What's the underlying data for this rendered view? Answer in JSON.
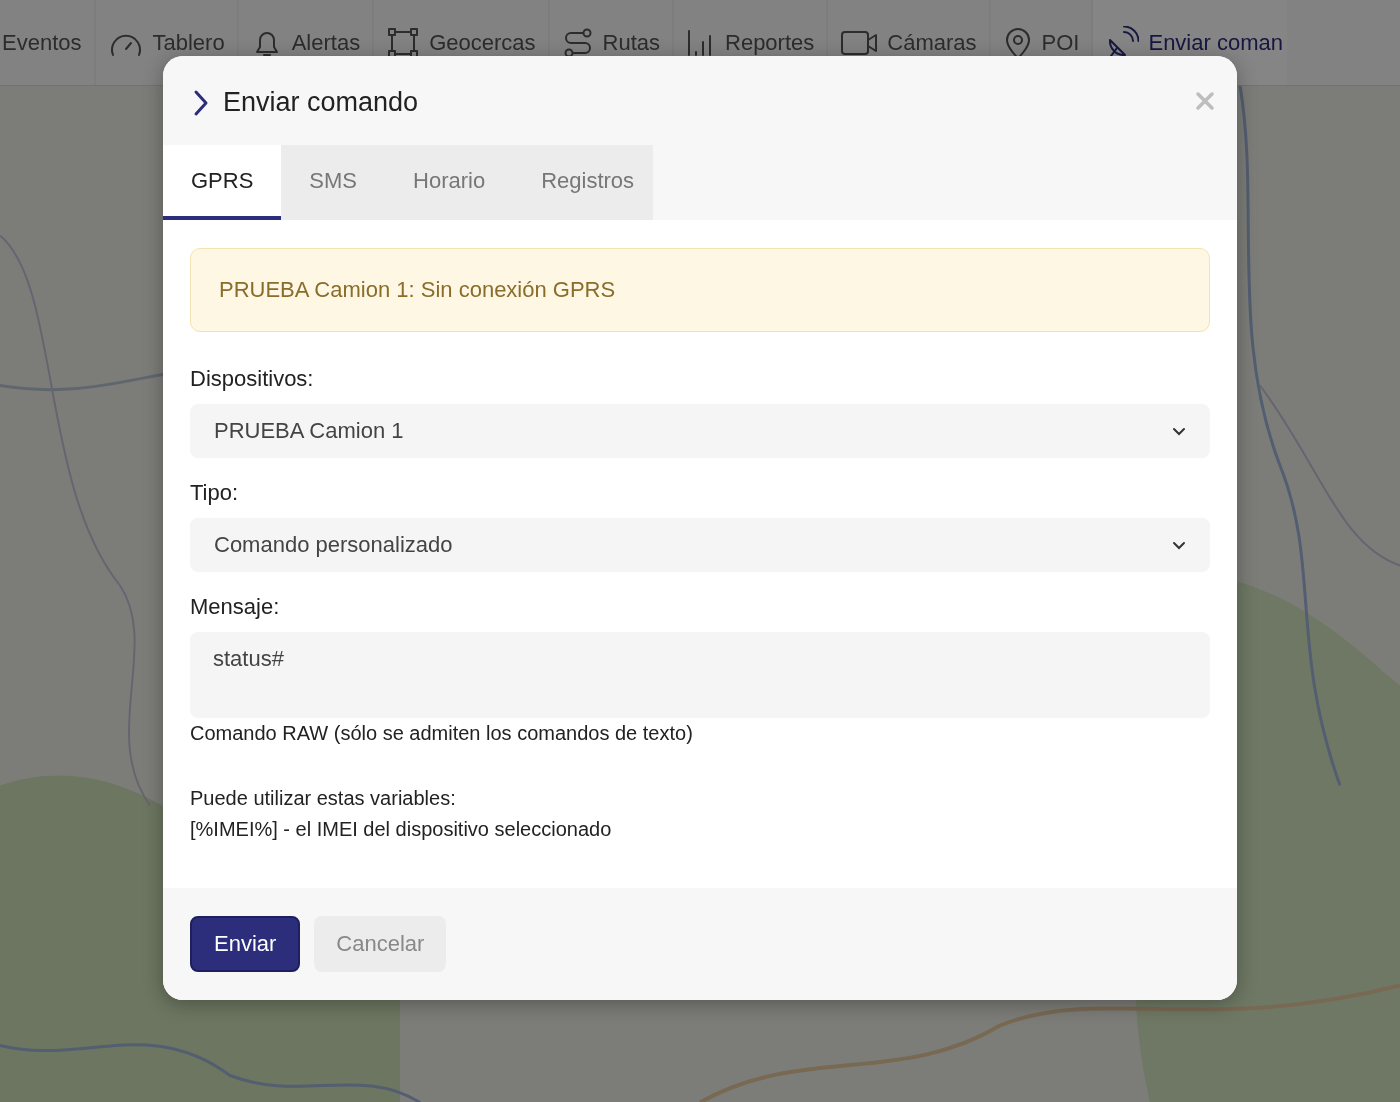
{
  "nav": [
    {
      "label": "Eventos",
      "selected": false
    },
    {
      "label": "Tablero",
      "selected": false
    },
    {
      "label": "Alertas",
      "selected": false
    },
    {
      "label": "Geocercas",
      "selected": false
    },
    {
      "label": "Rutas",
      "selected": false
    },
    {
      "label": "Reportes",
      "selected": false
    },
    {
      "label": "Cámaras",
      "selected": false
    },
    {
      "label": "POI",
      "selected": false
    },
    {
      "label": "Enviar coman",
      "selected": true
    }
  ],
  "dialog": {
    "title": "Enviar comando",
    "tabs": [
      {
        "label": "GPRS",
        "selected": true
      },
      {
        "label": "SMS",
        "selected": false
      },
      {
        "label": "Horario",
        "selected": false
      },
      {
        "label": "Registros",
        "selected": false
      }
    ],
    "alert": "PRUEBA Camion 1: Sin conexión GPRS",
    "fields": [
      {
        "kind": "select",
        "label": "Dispositivos:",
        "value": "PRUEBA Camion 1"
      },
      {
        "kind": "select",
        "label": "Tipo:",
        "value": "Comando personalizado"
      },
      {
        "kind": "textarea",
        "label": "Mensaje:",
        "value": "status#",
        "help": "Comando RAW (sólo se admiten los comandos de texto)"
      }
    ],
    "notes": [
      "Puede utilizar estas variables:",
      "[%IMEI%] - el IMEI del dispositivo seleccionado"
    ],
    "buttons": [
      {
        "label": "Enviar",
        "kind": "primary"
      },
      {
        "label": "Cancelar",
        "kind": "secondary"
      }
    ]
  }
}
